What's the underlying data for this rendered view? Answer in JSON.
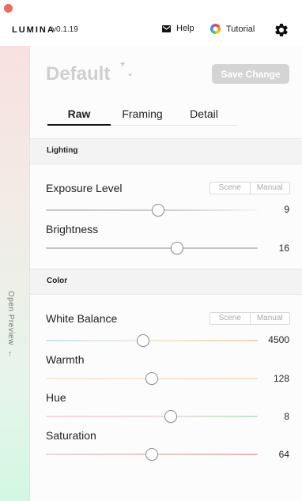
{
  "app": {
    "logo": "LUMINA",
    "version": "v0.1.19"
  },
  "header": {
    "help_label": "Help",
    "tutorial_label": "Tutorial"
  },
  "sidebar": {
    "open_preview_label": "Open Preview",
    "arrow": "←"
  },
  "preset": {
    "name": "Default",
    "modified_marker": "*",
    "save_label": "Save Change"
  },
  "tabs": [
    {
      "label": "Raw",
      "active": true
    },
    {
      "label": "Framing",
      "active": false
    },
    {
      "label": "Detail",
      "active": false
    }
  ],
  "sections": {
    "lighting": "Lighting",
    "color": "Color"
  },
  "mode_toggle": {
    "scene": "Scene",
    "manual": "Manual"
  },
  "sliders": {
    "exposure": {
      "label": "Exposure Level",
      "value": "9",
      "position": 0.53
    },
    "brightness": {
      "label": "Brightness",
      "value": "16",
      "position": 0.62
    },
    "white_balance": {
      "label": "White Balance",
      "value": "4500",
      "position": 0.46
    },
    "warmth": {
      "label": "Warmth",
      "value": "128",
      "position": 0.5
    },
    "hue": {
      "label": "Hue",
      "value": "8",
      "position": 0.59
    },
    "saturation": {
      "label": "Saturation",
      "value": "64",
      "position": 0.5
    }
  },
  "icons": {
    "help": "envelope-icon",
    "tutorial": "color-wheel-icon",
    "settings": "gear-icon"
  },
  "colors": {
    "close": "#ec6a5e",
    "save_disabled": "#d4d4d4",
    "accent": "#111111"
  }
}
